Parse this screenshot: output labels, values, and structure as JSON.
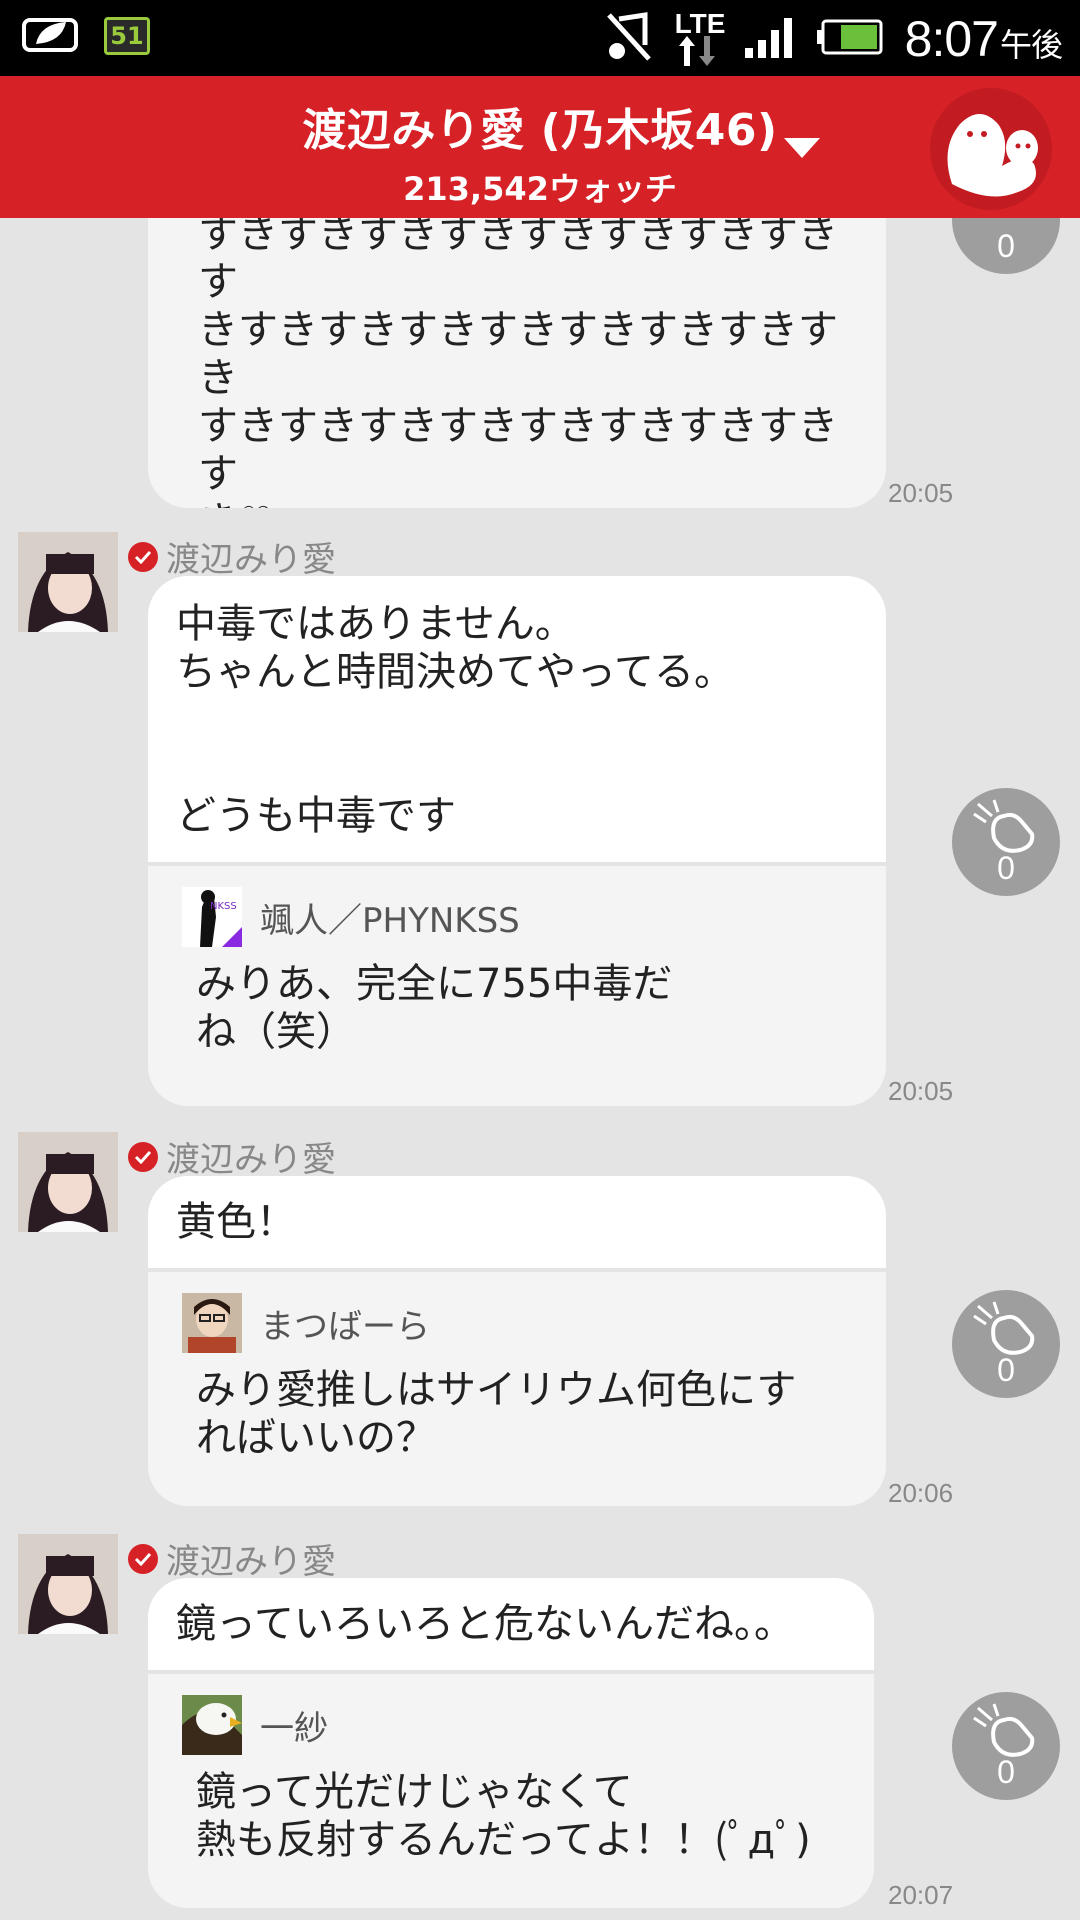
{
  "status_bar": {
    "notification_badge": "51",
    "network": "LTE",
    "time": "8:07",
    "ampm": "午後"
  },
  "header": {
    "title": "渡辺みり愛 (乃木坂46)",
    "watch_count": "213,542ウォッチ"
  },
  "messages": [
    {
      "text": "すきすきすきすきすきすきすきすきす\nきすきすきすきすきすきすきすきすき\nすきすきすきすきすきすきすきすきす\nき♡\n伝わった？わら",
      "time": "20:05",
      "clap_count": "0"
    },
    {
      "poster": "渡辺みり愛",
      "text": "中毒ではありません。\nちゃんと時間決めてやってる。\n\n\nどうも中毒です",
      "quote_user": "颯人／PHYNKSS",
      "quote_text": "みりあ、完全に755中毒だ\nね（笑）",
      "time": "20:05",
      "clap_count": "0"
    },
    {
      "poster": "渡辺みり愛",
      "text": "黄色！",
      "quote_user": "まつばーら",
      "quote_text": "みり愛推しはサイリウム何色にす\nればいいの？",
      "time": "20:06",
      "clap_count": "0"
    },
    {
      "poster": "渡辺みり愛",
      "text": "鏡っていろいろと危ないんだね。。",
      "quote_user": "一紗",
      "quote_text": "鏡って光だけじゃなくて\n熱も反射するんだってよ！！(ﾟдﾟ)",
      "time": "20:07",
      "clap_count": "0"
    }
  ],
  "colors": {
    "accent": "#d62127",
    "background": "#e4e4e4",
    "bubble": "#ffffff",
    "quote_bg": "#f4f4f4"
  }
}
